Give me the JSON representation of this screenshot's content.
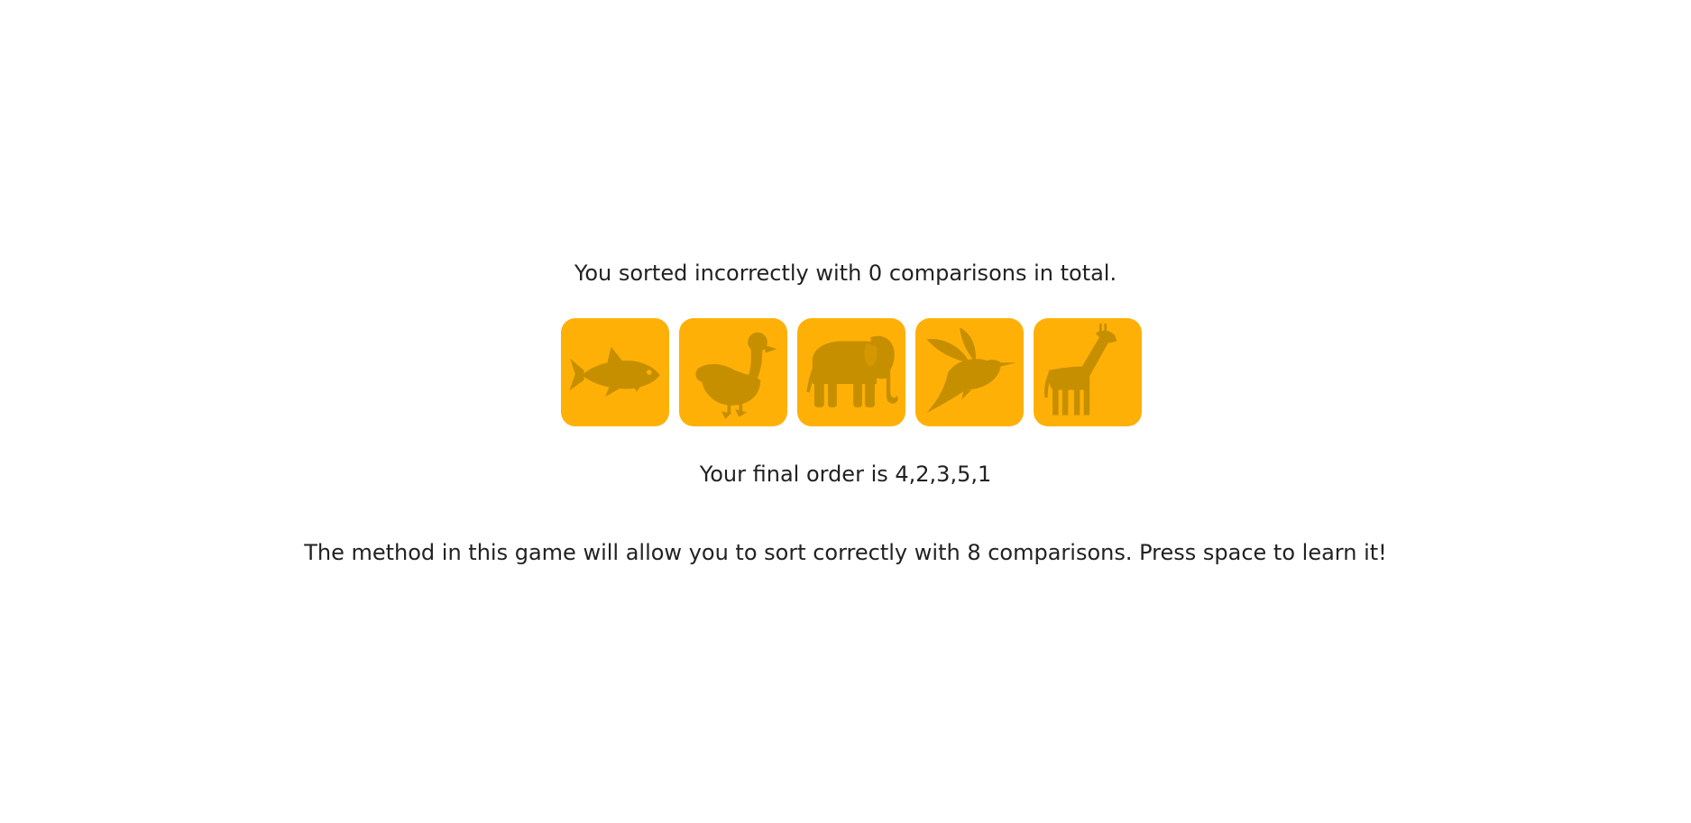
{
  "result": {
    "summary": "You sorted incorrectly with 0 comparisons in total.",
    "final_order_text": "Your final order is 4,2,3,5,1",
    "method_text": "The method in this game will allow you to sort correctly with 8 comparisons. Press space to learn it!"
  },
  "tiles": [
    {
      "icon": "fish-icon"
    },
    {
      "icon": "duck-icon"
    },
    {
      "icon": "elephant-icon"
    },
    {
      "icon": "hummingbird-icon"
    },
    {
      "icon": "giraffe-icon"
    }
  ],
  "colors": {
    "tile_background": "#FFB007",
    "icon_fill": "#C68F00",
    "text": "#222222",
    "page_background": "#FFFFFF"
  }
}
